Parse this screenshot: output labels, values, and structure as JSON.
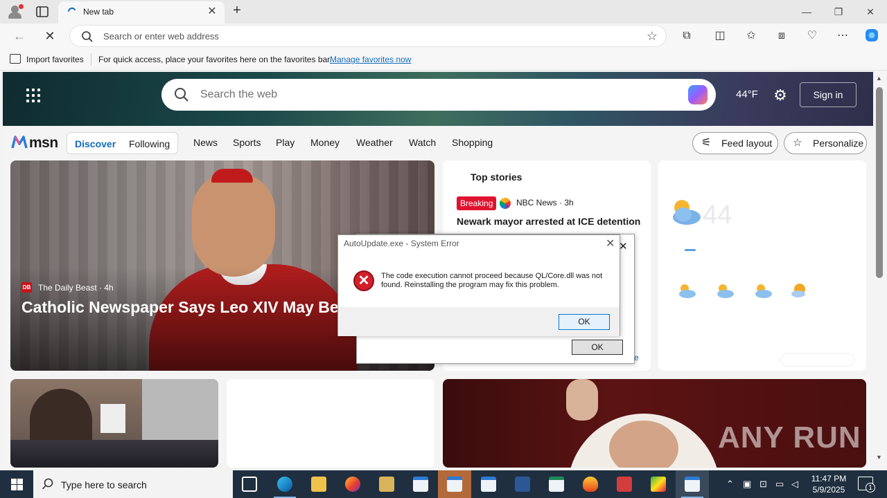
{
  "browser": {
    "tab": {
      "title": "New tab",
      "close": "✕"
    },
    "new_tab": "+",
    "window_controls": {
      "minimize": "—",
      "maximize": "❐",
      "close": "✕"
    },
    "address_bar": {
      "placeholder": "Search or enter web address"
    },
    "favorites_bar": {
      "import_label": "Import favorites",
      "message": "For quick access, place your favorites here on the favorites bar.",
      "manage_link": "Manage favorites now"
    }
  },
  "msn": {
    "search_placeholder": "Search the web",
    "temperature": "44°F",
    "sign_in": "Sign in",
    "logo_text": "msn",
    "feed_tabs": [
      {
        "label": "Discover",
        "selected": true
      },
      {
        "label": "Following",
        "selected": false
      }
    ],
    "nav": [
      "News",
      "Sports",
      "Play",
      "Money",
      "Weather",
      "Watch",
      "Shopping"
    ],
    "feed_layout": "Feed layout",
    "personalize": "Personalize",
    "main_story": {
      "source": "The Daily Beast",
      "age": "· 4h",
      "source_logo": "DB",
      "headline": "Catholic Newspaper Says Leo XIV May Be Pope’"
    },
    "top_stories": {
      "title": "Top stories",
      "badge": "Breaking",
      "source": "NBC News · 3h",
      "story": "Newark mayor arrested at ICE detention",
      "more_suffix": "e"
    },
    "weather_card": {
      "temp": "44"
    }
  },
  "dialogs": {
    "back": {
      "close": "✕",
      "ok": "OK"
    },
    "front": {
      "title": "AutoUpdate.exe - System Error",
      "close": "✕",
      "message": "The code execution cannot proceed because QL/Core.dll was not found. Reinstalling the program may fix this problem.",
      "icon": "✕",
      "ok": "OK"
    }
  },
  "watermark": "ANY RUN",
  "taskbar": {
    "search_placeholder": "Type here to search",
    "clock_time": "11:47 PM",
    "clock_date": "5/9/2025",
    "notification_count": "1"
  },
  "colors": {
    "accent": "#0f6cbd",
    "breaking": "#e0132f",
    "error": "#d1202b",
    "taskbar": "#1f2f3f"
  }
}
